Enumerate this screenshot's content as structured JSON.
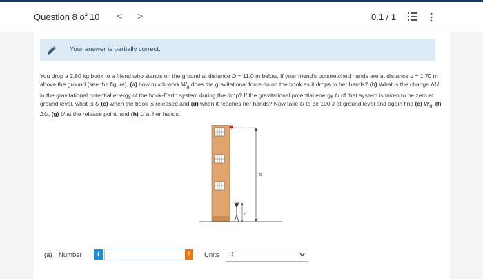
{
  "header": {
    "question_label": "Question 8 of 10",
    "prev_glyph": "<",
    "next_glyph": ">",
    "score": "0.1 / 1",
    "icons": [
      "chevron-left-icon",
      "chevron-right-icon",
      "list-icon",
      "more-vertical-icon"
    ]
  },
  "alert": {
    "text": "Your answer is partially correct.",
    "icon": "pencil-icon",
    "background": "#dcebf6"
  },
  "problem": {
    "segments": [
      {
        "t": "You drop a 2.80 kg book to a friend who stands on the ground at distance "
      },
      {
        "t": "D",
        "i": true
      },
      {
        "t": " = 11.0 m below. If your friend's outstretched hands are at distance "
      },
      {
        "t": "d",
        "i": true
      },
      {
        "t": " = 1.70 m above the ground (see the figure), "
      },
      {
        "t": "(a)",
        "b": true
      },
      {
        "t": " how much work "
      },
      {
        "t": "W",
        "i": true
      },
      {
        "t": "g",
        "sub": true
      },
      {
        "t": " does the gravitational force do on the book as it drops to her hands? "
      },
      {
        "t": "(b)",
        "b": true
      },
      {
        "t": " What is the change Δ"
      },
      {
        "t": "U",
        "i": true
      },
      {
        "t": " in the gravitational potential energy of the book-Earth system during the drop? If the gravitational potential energy "
      },
      {
        "t": "U",
        "i": true
      },
      {
        "t": " of that system is taken to be zero at ground level, what is "
      },
      {
        "t": "U",
        "i": true
      },
      {
        "t": " "
      },
      {
        "t": "(c)",
        "b": true
      },
      {
        "t": " when the book is released and "
      },
      {
        "t": "(d)",
        "b": true
      },
      {
        "t": " when it reaches her hands? Now take "
      },
      {
        "t": "U",
        "i": true
      },
      {
        "t": " to be 100 J at ground level and again find "
      },
      {
        "t": "(e)",
        "b": true
      },
      {
        "t": " "
      },
      {
        "t": "W",
        "i": true
      },
      {
        "t": "g",
        "sub": true
      },
      {
        "t": ", "
      },
      {
        "t": "(f)",
        "b": true
      },
      {
        "t": " Δ"
      },
      {
        "t": "U",
        "i": true
      },
      {
        "t": ", "
      },
      {
        "t": "(g)",
        "b": true
      },
      {
        "t": " "
      },
      {
        "t": "U",
        "i": true
      },
      {
        "t": " at the release point, and "
      },
      {
        "t": "(h)",
        "b": true
      },
      {
        "t": " "
      },
      {
        "t": "U",
        "u": true
      },
      {
        "t": " at her hands."
      }
    ]
  },
  "figure": {
    "D_label": "D",
    "d_label": "d",
    "building_color": "#e0a46c"
  },
  "answer": {
    "part_label": "(a)",
    "number_label": "Number",
    "info_badge": "i",
    "value": "",
    "warning_badge": "!",
    "units_label": "Units",
    "units_value": "J"
  }
}
